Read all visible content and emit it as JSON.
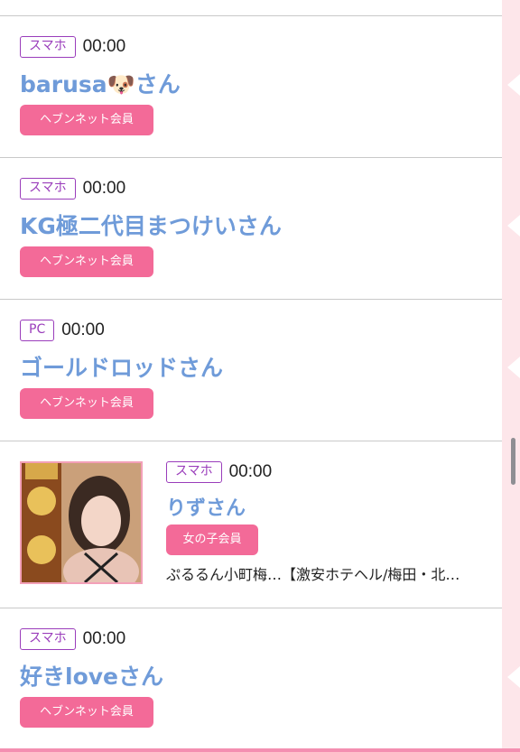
{
  "entries": [
    {
      "device": "スマホ",
      "time": "00:00",
      "name": "barusa🐶さん",
      "badge": "ヘブンネット会員"
    },
    {
      "device": "スマホ",
      "time": "00:00",
      "name": "KG極二代目まつけいさん",
      "badge": "ヘブンネット会員"
    },
    {
      "device": "PC",
      "time": "00:00",
      "name": "ゴールドロッドさん",
      "badge": "ヘブンネット会員"
    },
    {
      "device": "スマホ",
      "time": "00:00",
      "name": "りずさん",
      "badge": "女の子会員",
      "shop": "ぷるるん小町梅…【激安ホテヘル/梅田・北…"
    },
    {
      "device": "スマホ",
      "time": "00:00",
      "name": "好きloveさん",
      "badge": "ヘブンネット会員"
    }
  ],
  "colors": {
    "accent_pink": "#f36a98",
    "name_blue": "#6f9bd9",
    "device_purple": "#9a3dbb"
  }
}
